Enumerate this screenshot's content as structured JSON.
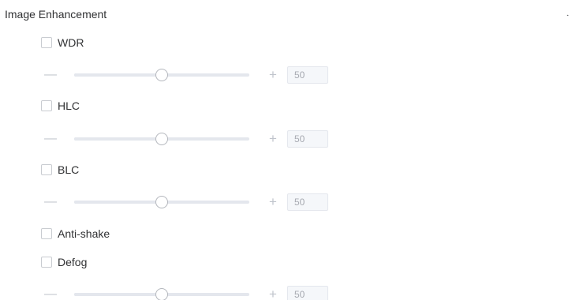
{
  "section": {
    "title": "Image Enhancement",
    "collapse_icon": "chevron-down-icon"
  },
  "settings": {
    "wdr": {
      "label": "WDR",
      "checked": false,
      "value": "50",
      "level": 0.5
    },
    "hlc": {
      "label": "HLC",
      "checked": false,
      "value": "50",
      "level": 0.5
    },
    "blc": {
      "label": "BLC",
      "checked": false,
      "value": "50",
      "level": 0.5
    },
    "anti_shake": {
      "label": "Anti-shake",
      "checked": false
    },
    "defog": {
      "label": "Defog",
      "checked": false,
      "value": "50",
      "level": 0.5
    }
  },
  "controls": {
    "minus_symbol": "—",
    "plus_symbol": "+"
  }
}
